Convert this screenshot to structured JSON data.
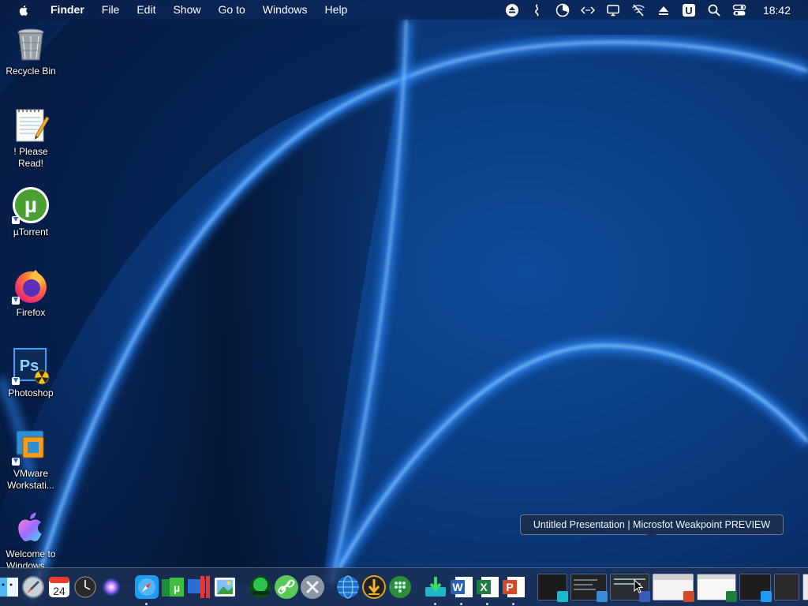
{
  "menubar": {
    "app_name": "Finder",
    "items": [
      "File",
      "Edit",
      "Show",
      "Go to",
      "Windows",
      "Help"
    ],
    "status_icons": [
      "eject-icon",
      "tilde-icon",
      "clock-pie-icon",
      "code-arrows-icon",
      "display-icon",
      "wifi-off-icon",
      "upload-icon",
      "u-badge-icon",
      "search-icon",
      "control-center-icon"
    ],
    "u_badge_label": "U",
    "clock": "18:42"
  },
  "desktop": {
    "icons": [
      {
        "name": "recycle-bin",
        "label": "Recycle Bin"
      },
      {
        "name": "please-read",
        "label": "! Please Read!"
      },
      {
        "name": "utorrent",
        "label": "µTorrent"
      },
      {
        "name": "firefox",
        "label": "Firefox"
      },
      {
        "name": "photoshop",
        "label": "Photoshop"
      },
      {
        "name": "vmware",
        "label": "VMware\nWorkstati..."
      },
      {
        "name": "welcome",
        "label": "Welcome to\nWindows ..."
      }
    ],
    "ps_label": "Ps",
    "utorrent_glyph": "µ"
  },
  "calendar": {
    "day": "24"
  },
  "tooltip": {
    "text": "Untitled Presentation | Microsfot Weakpoint PREVIEW"
  },
  "dock": {
    "word_glyph": "W",
    "excel_glyph": "X",
    "powerpoint_glyph": "P"
  },
  "colors": {
    "accent_blue": "#2f8cff",
    "menubar_bg": "#0c1e46",
    "dock_bg": "#1e3255"
  }
}
